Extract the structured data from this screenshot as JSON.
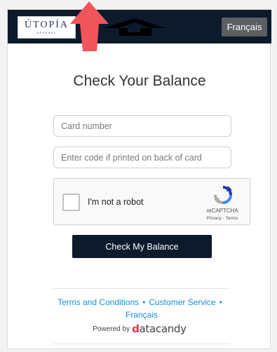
{
  "header": {
    "logo": {
      "wordmark": "ÚTOPÍA",
      "tagline": "APPAREL"
    },
    "language_button": "Français"
  },
  "main": {
    "title": "Check Your Balance",
    "card_number": {
      "value": "",
      "placeholder": "Card number"
    },
    "pin": {
      "value": "",
      "placeholder": "Enter code if printed on back of card"
    },
    "captcha": {
      "label": "I'm not a robot",
      "brand": "reCAPTCHA",
      "links": "Privacy - Terms",
      "checked": false
    },
    "submit_label": "Check My Balance"
  },
  "footer": {
    "links": {
      "terms": "Terms and Conditions",
      "service": "Customer Service",
      "language": "Français",
      "separator": "•"
    },
    "powered_by": "Powered by",
    "brand_prefix": "d",
    "brand_rest": "atacandy"
  },
  "colors": {
    "header_bg": "#0c1a2c",
    "language_button_bg": "#5b5f63",
    "link": "#1a8fd1",
    "annotation_arrow_red": "#f0555a"
  },
  "icons": {
    "annotation_1": "red-up-arrow-icon",
    "annotation_2": "black-left-arrow-icon",
    "captcha": "recaptcha-logo-icon"
  }
}
